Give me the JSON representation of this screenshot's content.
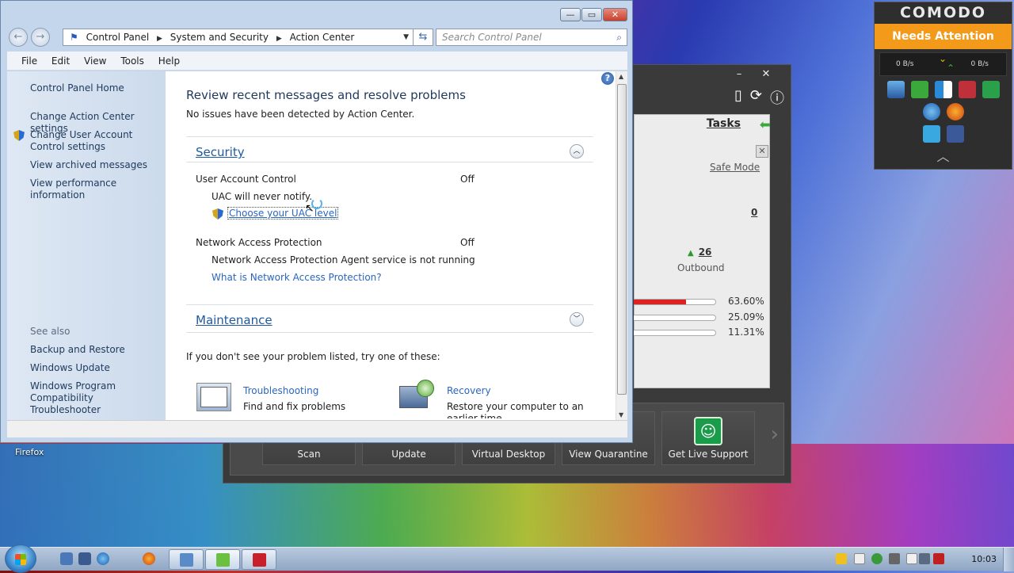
{
  "desktop": {
    "icon_label": "Firefox"
  },
  "comodo_widget": {
    "brand": "COMODO",
    "status": "Needs Attention",
    "in_speed": "0 B/s",
    "out_speed": "0 B/s",
    "colors": {
      "status_bg": "#f39a1a"
    }
  },
  "comodo_main": {
    "minimize": "–",
    "close": "✕",
    "tasks_label": "Tasks",
    "safe_mode_label": "Safe Mode",
    "inbound_value": "0",
    "outbound_value": "26",
    "outbound_label": "Outbound",
    "usage": [
      {
        "label": "63.60%",
        "fraction": 0.636
      },
      {
        "label": "25.09%",
        "fraction": 0.2509
      },
      {
        "label": "11.31%",
        "fraction": 0.1131
      }
    ],
    "buttons": [
      "Scan",
      "Update",
      "Virtual Desktop",
      "View Quarantine",
      "Get Live Support"
    ]
  },
  "action_center": {
    "window_controls": {
      "minimize": "—",
      "maximize": "▭",
      "close": "✕"
    },
    "breadcrumb": [
      "Control Panel",
      "System and Security",
      "Action Center"
    ],
    "search_placeholder": "Search Control Panel",
    "menu": [
      "File",
      "Edit",
      "View",
      "Tools",
      "Help"
    ],
    "sidebar": {
      "home": "Control Panel Home",
      "links": [
        "Change Action Center settings",
        "Change User Account Control settings",
        "View archived messages",
        "View performance information"
      ],
      "see_also_heading": "See also",
      "see_also": [
        "Backup and Restore",
        "Windows Update",
        "Windows Program Compatibility Troubleshooter"
      ]
    },
    "main": {
      "heading": "Review recent messages and resolve problems",
      "subheading": "No issues have been detected by Action Center.",
      "security": {
        "title": "Security",
        "uac_label": "User Account Control",
        "uac_status": "Off",
        "uac_detail": "UAC will never notify.",
        "uac_link": "Choose your UAC level",
        "nap_label": "Network Access Protection",
        "nap_status": "Off",
        "nap_detail": "Network Access Protection Agent service is not running",
        "nap_link": "What is Network Access Protection?"
      },
      "maintenance": {
        "title": "Maintenance"
      },
      "suggestion": "If you don't see your problem listed, try one of these:",
      "troubleshooting": {
        "title": "Troubleshooting",
        "desc": "Find and fix problems"
      },
      "recovery": {
        "title": "Recovery",
        "desc": "Restore your computer to an earlier time"
      }
    }
  },
  "taskbar": {
    "clock": "10:03"
  }
}
